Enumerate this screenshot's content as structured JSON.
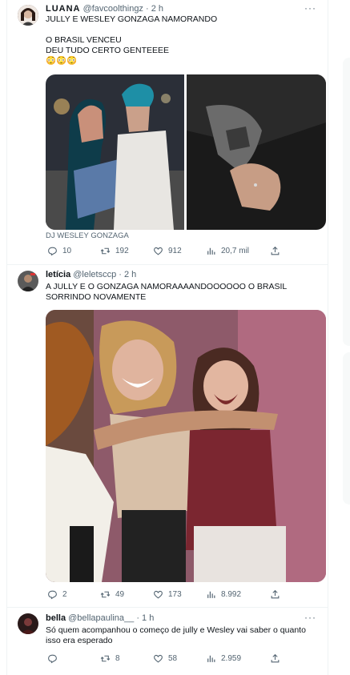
{
  "tweets": [
    {
      "name": "LUANA",
      "handle": "@favcoolthingz",
      "time": "· 2 h",
      "more": "···",
      "text": "JULLY E WESLEY GONZAGA NAMORANDO\n\nO BRASIL VENCEU\nDEU TUDO CERTO GENTEEEE\n😳😳😳",
      "media_credit": "DJ WESLEY GONZAGA",
      "stats": {
        "replies": "10",
        "retweets": "192",
        "likes": "912",
        "views": "20,7 mil"
      }
    },
    {
      "name": "letícia",
      "handle": "@leletsccp",
      "time": "· 2 h",
      "more": "···",
      "text": "A JULLY E O GONZAGA NAMORAAAANDOOOOOO O BRASIL SORRINDO NOVAMENTE",
      "stats": {
        "replies": "2",
        "retweets": "49",
        "likes": "173",
        "views": "8.992"
      }
    },
    {
      "name": "bella",
      "handle": "@bellapaulina__",
      "time": "· 1 h",
      "more": "···",
      "text": "Só quem acompanhou o começo de jully e Wesley vai saber o quanto isso era esperado",
      "stats": {
        "replies": "",
        "retweets": "8",
        "likes": "58",
        "views": "2.959"
      }
    }
  ],
  "icons": [
    "reply-icon",
    "retweet-icon",
    "like-icon",
    "views-icon",
    "share-icon",
    "more-icon"
  ],
  "colors": {
    "text": "#0f1419",
    "secondary": "#536471",
    "border": "#eff3f4"
  }
}
